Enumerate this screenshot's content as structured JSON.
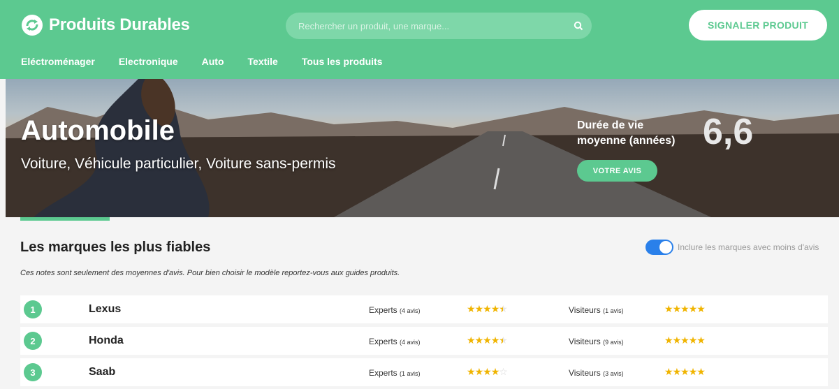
{
  "brand": {
    "name": "Produits Durables",
    "color": "#5cc990"
  },
  "search": {
    "placeholder": "Rechercher un produit, une marque..."
  },
  "header": {
    "report_label": "SIGNALER PRODUIT"
  },
  "nav": {
    "items": [
      "Eléctroménager",
      "Electronique",
      "Auto",
      "Textile",
      "Tous les produits"
    ]
  },
  "hero": {
    "title": "Automobile",
    "subtitle": "Voiture, Véhicule particulier, Voiture sans-permis",
    "lifespan_label": "Durée de vie moyenne (années)",
    "lifespan_value": "6,6",
    "avis_label": "VOTRE AVIS"
  },
  "section": {
    "title": "Les marques les plus fiables",
    "note": "Ces notes sont seulement des moyennes d'avis. Pour bien choisir le modèle reportez-vous aux guides produits.",
    "toggle_label": "Inclure les marques avec moins d'avis",
    "toggle_on": true
  },
  "brands": [
    {
      "rank": "1",
      "name": "Lexus",
      "experts_label": "Experts",
      "experts_count": "(4 avis)",
      "experts_rating": 4.5,
      "visitors_label": "Visiteurs",
      "visitors_count": "(1 avis)",
      "visitors_rating": 5
    },
    {
      "rank": "2",
      "name": "Honda",
      "experts_label": "Experts",
      "experts_count": "(4 avis)",
      "experts_rating": 4.5,
      "visitors_label": "Visiteurs",
      "visitors_count": "(9 avis)",
      "visitors_rating": 5
    },
    {
      "rank": "3",
      "name": "Saab",
      "experts_label": "Experts",
      "experts_count": "(1 avis)",
      "experts_rating": 4,
      "visitors_label": "Visiteurs",
      "visitors_count": "(3 avis)",
      "visitors_rating": 5
    }
  ]
}
